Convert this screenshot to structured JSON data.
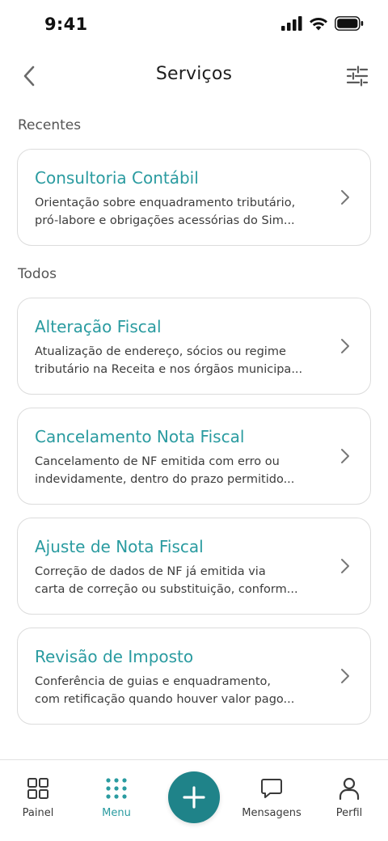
{
  "status_bar": {
    "time": "9:41"
  },
  "header": {
    "title": "Serviços"
  },
  "sections": {
    "recent_label": "Recentes",
    "all_label": "Todos"
  },
  "recent_services": [
    {
      "title": "Consultoria Contábil",
      "desc_line1": "Orientação sobre enquadramento tributário,",
      "desc_line2": "pró-labore e obrigações acessórias do Sim..."
    }
  ],
  "all_services": [
    {
      "title": "Alteração Fiscal",
      "desc_line1": "Atualização de endereço, sócios ou regime",
      "desc_line2": "tributário na Receita e nos órgãos municipa..."
    },
    {
      "title": "Cancelamento Nota Fiscal",
      "desc_line1": "Cancelamento de NF emitida com erro ou",
      "desc_line2": "indevidamente, dentro do prazo permitido..."
    },
    {
      "title": "Ajuste de Nota Fiscal",
      "desc_line1": "Correção de dados de NF já emitida via",
      "desc_line2": "carta de correção ou substituição, conform..."
    },
    {
      "title": "Revisão de Imposto",
      "desc_line1": "Conferência de guias e enquadramento,",
      "desc_line2": "com retificação quando houver valor pago..."
    }
  ],
  "bottom_nav": {
    "items": [
      {
        "label": "Painel",
        "icon": "grid-icon",
        "active": false
      },
      {
        "label": "Menu",
        "icon": "dots-grid-icon",
        "active": true
      },
      {
        "label": "Mensagens",
        "icon": "chat-bubble-icon",
        "active": false
      },
      {
        "label": "Perfil",
        "icon": "person-icon",
        "active": false
      }
    ],
    "fab_icon": "plus-icon"
  },
  "colors": {
    "accent": "#2a9ba0",
    "fab": "#1f8389",
    "border": "#dcdcdc"
  }
}
